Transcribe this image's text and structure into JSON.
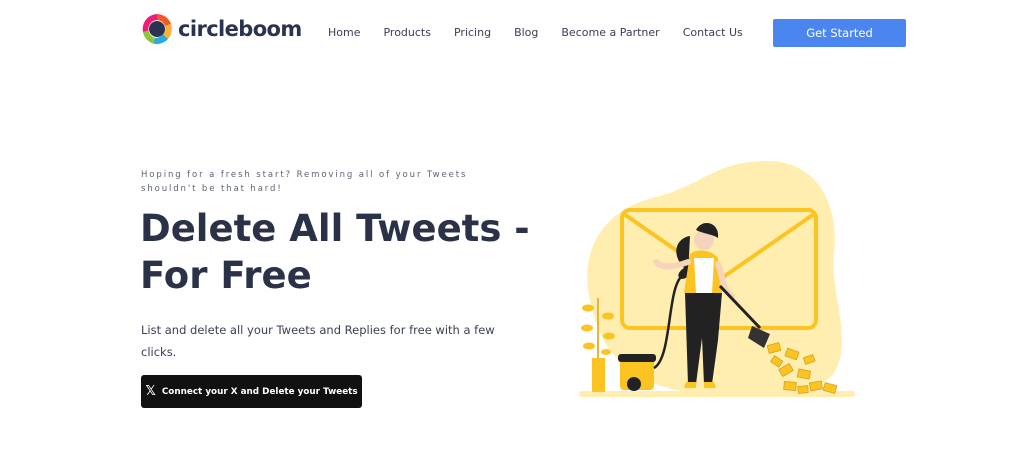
{
  "brand": {
    "name": "circleboom"
  },
  "nav": {
    "items": [
      "Home",
      "Products",
      "Pricing",
      "Blog",
      "Become a Partner",
      "Contact Us"
    ],
    "cta_label": "Get Started"
  },
  "hero": {
    "eyebrow": "Hoping for a fresh start? Removing all of your Tweets shouldn't be that hard!",
    "title_line1": "Delete All Tweets -",
    "title_line2": "For Free",
    "lead": "List and delete all your Tweets and Replies for free with a few clicks.",
    "button_label": "Connect your X and Delete your Tweets",
    "button_icon": "x-logo-icon"
  },
  "colors": {
    "accent": "#4b86f0",
    "heading": "#2b3147",
    "illustration_yellow": "#fbc423",
    "illustration_blob": "#ffeeb0"
  }
}
